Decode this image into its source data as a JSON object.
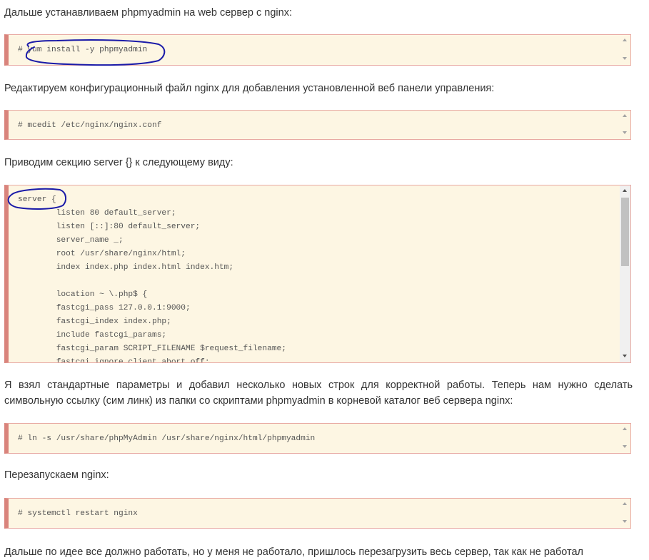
{
  "paragraphs": {
    "p1": "Дальше устанавливаем phpmyadmin на web сервер с nginx:",
    "p2": "Редактируем конфигурационный файл nginx для добавления установленной веб панели управления:",
    "p3": "Приводим секцию server {} к следующему виду:",
    "p4": "Я взял стандартные параметры и добавил несколько новых строк для корректной работы. Теперь нам нужно сделать символьную ссылку (сим линк) из папки со скриптами phpmyadmin в корневой каталог веб сервера nginx:",
    "p5": "Перезапускаем nginx:",
    "p6": "Дальше по идее все должно работать, но у меня не работало, пришлось перезагрузить весь сервер, так как не работал"
  },
  "code": {
    "c1": "# yum install -y phpmyadmin",
    "c2": "# mcedit /etc/nginx/nginx.conf",
    "c3": "server {\n        listen 80 default_server;\n        listen [::]:80 default_server;\n        server_name _;\n        root /usr/share/nginx/html;\n        index index.php index.html index.htm;\n\n        location ~ \\.php$ {\n        fastcgi_pass 127.0.0.1:9000;\n        fastcgi_index index.php;\n        include fastcgi_params;\n        fastcgi_param SCRIPT_FILENAME $request_filename;\n        fastcgi_ignore_client_abort off;",
    "c4": "# ln -s /usr/share/phpMyAdmin /usr/share/nginx/html/phpmyadmin",
    "c5": "# systemctl restart nginx"
  },
  "colors": {
    "code_background": "#fdf6e3",
    "code_left_border": "#d9847c",
    "annotation_ink": "#1a1aa8"
  }
}
